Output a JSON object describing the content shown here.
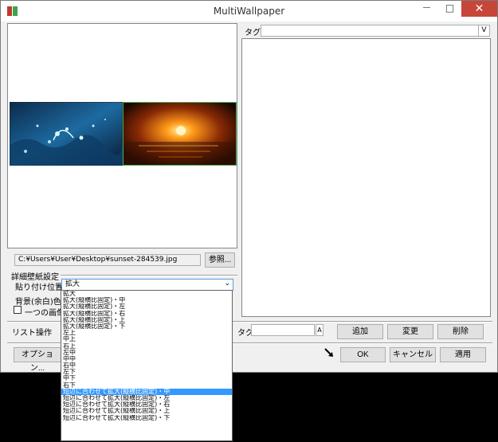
{
  "window": {
    "title": "MultiWallpaper",
    "close_glyph": "✕",
    "min_glyph": "—",
    "max_glyph": "□"
  },
  "preview": {
    "file_path": "C:¥Users¥User¥Desktop¥sunset-284539.jpg",
    "browse_label": "参照..."
  },
  "tag_panel": {
    "tag_label": "タグ",
    "tag_combo_arrow": "V"
  },
  "settings": {
    "group_label": "詳細壁紙設定",
    "paste_position_label": "貼り付け位置",
    "paste_position_value": "拡大",
    "bg_color_label": "背景(余白)色",
    "single_image_label": "一つの画像を"
  },
  "list_ops": {
    "label": "リスト操作",
    "tag_label": "タグ",
    "tag_add_glyph": "A",
    "add_label": "追加",
    "change_label": "変更",
    "delete_label": "削除"
  },
  "footer": {
    "options_label": "オプション...",
    "ok_label": "OK",
    "cancel_label": "キャンセル",
    "apply_label": "適用"
  },
  "dropdown": {
    "options": [
      "拡大",
      "拡大(縦横比固定)・中",
      "拡大(縦横比固定)・左",
      "拡大(縦横比固定)・右",
      "拡大(縦横比固定)・上",
      "拡大(縦横比固定)・下",
      "左上",
      "中上",
      "右上",
      "左中",
      "中中",
      "右中",
      "左下",
      "中下",
      "右下",
      "短辺に合わせて拡大(縦横比固定)・中",
      "短辺に合わせて拡大(縦横比固定)・左",
      "短辺に合わせて拡大(縦横比固定)・右",
      "短辺に合わせて拡大(縦横比固定)・上",
      "短辺に合わせて拡大(縦横比固定)・下"
    ],
    "selected_index": 15
  },
  "colors": {
    "selection": "#3399ff",
    "close": "#c7463a",
    "monitor_border_active": "#4caf50"
  }
}
